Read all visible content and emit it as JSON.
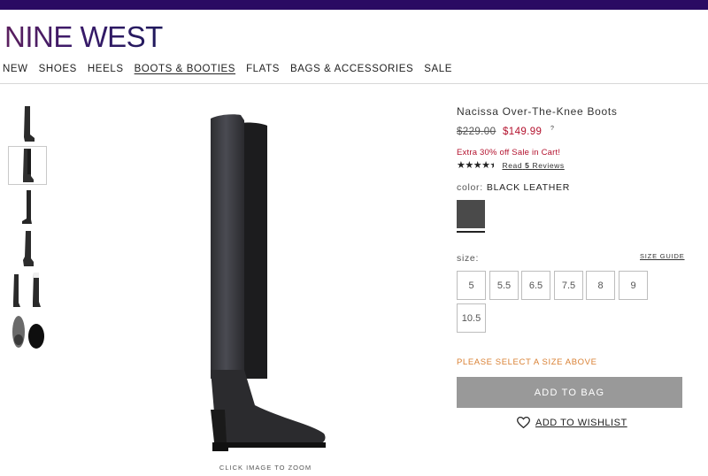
{
  "brand": {
    "logo_text": "NINE WEST",
    "bar_color": "#2a0a63"
  },
  "nav": {
    "items": [
      {
        "label": "NEW",
        "active": false
      },
      {
        "label": "SHOES",
        "active": false
      },
      {
        "label": "HEELS",
        "active": false
      },
      {
        "label": "BOOTS & BOOTIES",
        "active": true
      },
      {
        "label": "FLATS",
        "active": false
      },
      {
        "label": "BAGS & ACCESSORIES",
        "active": false
      },
      {
        "label": "SALE",
        "active": false
      }
    ]
  },
  "gallery": {
    "thumbnails": [
      "boot-side-view",
      "boot-front-view",
      "boot-other-side-view",
      "boot-three-quarter-view",
      "boot-pair-view",
      "boot-sole-view"
    ],
    "selected_index": 1,
    "zoom_hint": "CLICK IMAGE TO ZOOM"
  },
  "product": {
    "title": "Nacissa Over-The-Knee Boots",
    "price_original": "$229.00",
    "price_sale": "$149.99",
    "price_help": "?",
    "promo": "Extra 30% off Sale in Cart!",
    "rating": 4.5,
    "reviews_prefix": "Read",
    "reviews_count": "5",
    "reviews_suffix": "Reviews",
    "color_label": "color:",
    "color_value": "BLACK LEATHER",
    "swatch_color": "#4a4a4a",
    "size_label": "size:",
    "size_guide": "SIZE GUIDE",
    "sizes": [
      "5",
      "5.5",
      "6.5",
      "7.5",
      "8",
      "9",
      "10.5"
    ],
    "warning": "PLEASE SELECT A SIZE ABOVE",
    "add_to_bag": "ADD TO BAG",
    "wishlist": "ADD TO WISHLIST"
  }
}
